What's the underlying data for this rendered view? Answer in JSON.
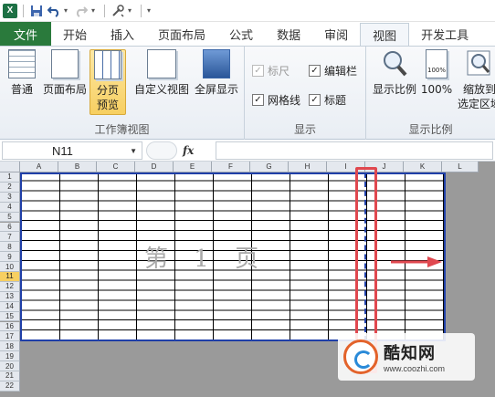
{
  "quick_access": {
    "app_icon": "X",
    "icons": [
      "excel-icon",
      "save-icon",
      "undo-icon",
      "redo-icon",
      "customize-icon"
    ]
  },
  "tabs": [
    {
      "label": "文件",
      "name": "tab-file"
    },
    {
      "label": "开始",
      "name": "tab-home"
    },
    {
      "label": "插入",
      "name": "tab-insert"
    },
    {
      "label": "页面布局",
      "name": "tab-page-layout"
    },
    {
      "label": "公式",
      "name": "tab-formulas"
    },
    {
      "label": "数据",
      "name": "tab-data"
    },
    {
      "label": "审阅",
      "name": "tab-review"
    },
    {
      "label": "视图",
      "name": "tab-view",
      "active": true
    },
    {
      "label": "开发工具",
      "name": "tab-developer"
    }
  ],
  "ribbon": {
    "workbook_views": {
      "label": "工作簿视图",
      "normal": "普通",
      "page_layout": "页面布局",
      "page_break_line1": "分页",
      "page_break_line2": "预览",
      "custom_views": "自定义视图",
      "full_screen": "全屏显示"
    },
    "show": {
      "label": "显示",
      "ruler": "标尺",
      "formula_bar": "编辑栏",
      "gridlines": "网格线",
      "headings": "标题",
      "check": "✓"
    },
    "zoom": {
      "label": "显示比例",
      "zoom": "显示比例",
      "hundred": "100%",
      "zoom_sel_line1": "缩放到",
      "zoom_sel_line2": "选定区域"
    }
  },
  "formula_bar": {
    "name_box": "N11",
    "fx": "fx",
    "value": ""
  },
  "sheet": {
    "columns": [
      "A",
      "B",
      "C",
      "D",
      "E",
      "F",
      "G",
      "H",
      "I",
      "J",
      "K",
      "L"
    ],
    "rows": [
      "1",
      "2",
      "3",
      "4",
      "5",
      "6",
      "7",
      "8",
      "9",
      "10",
      "11",
      "12",
      "13",
      "14",
      "15",
      "16",
      "17",
      "18",
      "19",
      "20",
      "21",
      "22"
    ],
    "selected_row": "11",
    "watermark": "第 1 页"
  },
  "logo": {
    "title": "酷知网",
    "url": "www.coozhi.com"
  },
  "colors": {
    "file_tab": "#2a7a3c",
    "page_border": "#1f3fa8",
    "highlight": "#e0484f",
    "selected_button": "#f7cf61"
  }
}
